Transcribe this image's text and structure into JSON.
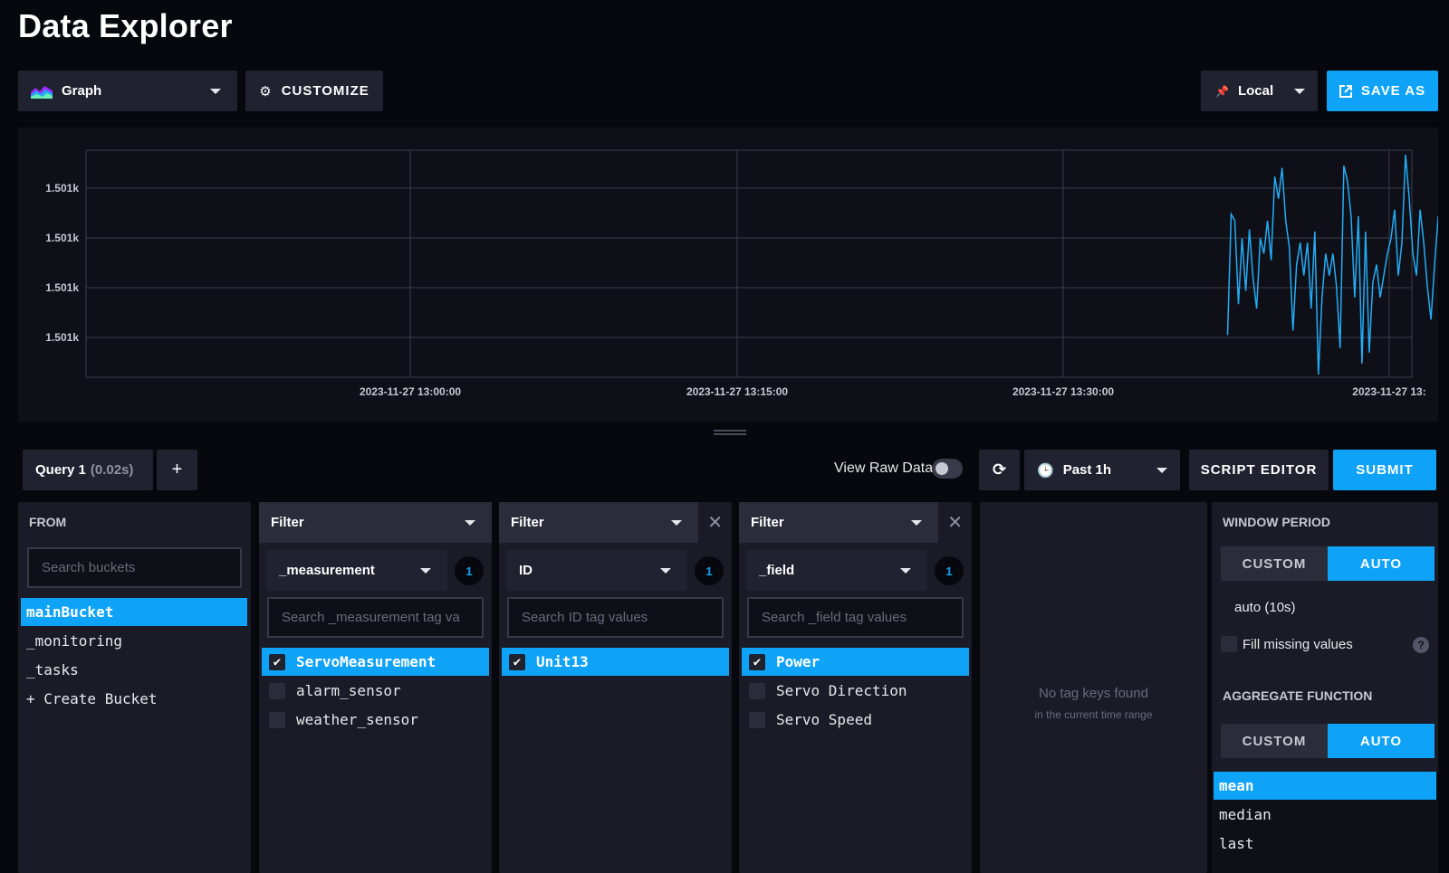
{
  "page": {
    "title": "Data Explorer"
  },
  "toolbar": {
    "graph_type": "Graph",
    "customize": "CUSTOMIZE",
    "timezone": "Local",
    "save_as": "SAVE AS"
  },
  "chart_data": {
    "type": "line",
    "title": "",
    "xlabel": "",
    "ylabel": "",
    "y_tick_labels": [
      "1.501k",
      "1.501k",
      "1.501k",
      "1.501k"
    ],
    "x_tick_labels": [
      "2023-11-27 13:00:00",
      "2023-11-27 13:15:00",
      "2023-11-27 13:30:00",
      "2023-11-27 13:"
    ],
    "grid": true,
    "series_color": "#22adf6",
    "series": [
      {
        "x": [
          "13:37:30",
          "13:37:40",
          "13:37:50",
          "13:38:00",
          "13:38:10",
          "13:38:20",
          "13:38:30",
          "13:38:40",
          "13:38:50",
          "13:39:00",
          "13:39:10",
          "13:39:20",
          "13:39:30",
          "13:39:40",
          "13:39:50",
          "13:40:00",
          "13:40:10",
          "13:40:20",
          "13:40:30",
          "13:40:40",
          "13:40:50",
          "13:41:00",
          "13:41:10",
          "13:41:20",
          "13:41:30",
          "13:41:40",
          "13:41:50",
          "13:42:00",
          "13:42:10",
          "13:42:20",
          "13:42:30",
          "13:42:40",
          "13:42:50",
          "13:43:00",
          "13:43:10",
          "13:43:20",
          "13:43:30",
          "13:43:40",
          "13:43:50",
          "13:44:00",
          "13:44:10",
          "13:44:20",
          "13:44:30",
          "13:44:40",
          "13:44:50",
          "13:45:00",
          "13:45:10",
          "13:45:20",
          "13:45:30",
          "13:45:40",
          "13:45:50",
          "13:46:00",
          "13:46:10",
          "13:46:20",
          "13:46:30",
          "13:46:40",
          "13:46:50",
          "13:47:00",
          "13:47:10",
          "13:47:20",
          "13:47:30"
        ],
        "values": [
          0.18,
          0.73,
          0.7,
          0.32,
          0.62,
          0.38,
          0.66,
          0.44,
          0.3,
          0.62,
          0.55,
          0.7,
          0.52,
          0.9,
          0.8,
          0.94,
          0.7,
          0.58,
          0.2,
          0.5,
          0.6,
          0.45,
          0.6,
          0.3,
          0.65,
          0.0,
          0.35,
          0.55,
          0.45,
          0.55,
          0.4,
          0.12,
          0.95,
          0.88,
          0.72,
          0.35,
          0.72,
          0.05,
          0.65,
          0.1,
          0.42,
          0.5,
          0.35,
          0.45,
          0.55,
          0.62,
          0.75,
          0.45,
          0.6,
          1.0,
          0.8,
          0.55,
          0.45,
          0.75,
          0.6,
          0.4,
          0.25,
          0.5,
          0.72,
          0.55,
          0.7
        ]
      }
    ]
  },
  "query": {
    "tab_label": "Query 1",
    "tab_timing": "(0.02s)",
    "add_label": "+",
    "view_raw": "View Raw Data",
    "time_range": "Past 1h",
    "script_editor": "SCRIPT EDITOR",
    "submit": "SUBMIT"
  },
  "from": {
    "title": "FROM",
    "search_placeholder": "Search buckets",
    "buckets": [
      "mainBucket",
      "_monitoring",
      "_tasks",
      "+ Create Bucket"
    ]
  },
  "filters": [
    {
      "label": "Filter",
      "key": "_measurement",
      "count": "1",
      "search_placeholder": "Search _measurement tag va",
      "items": [
        {
          "label": "ServoMeasurement",
          "checked": true
        },
        {
          "label": "alarm_sensor",
          "checked": false
        },
        {
          "label": "weather_sensor",
          "checked": false
        }
      ]
    },
    {
      "label": "Filter",
      "key": "ID",
      "count": "1",
      "search_placeholder": "Search ID tag values",
      "items": [
        {
          "label": "Unit13",
          "checked": true
        }
      ]
    },
    {
      "label": "Filter",
      "key": "_field",
      "count": "1",
      "search_placeholder": "Search _field tag values",
      "items": [
        {
          "label": "Power",
          "checked": true
        },
        {
          "label": "Servo Direction",
          "checked": false
        },
        {
          "label": "Servo Speed",
          "checked": false
        }
      ]
    }
  ],
  "empty": {
    "message": "No tag keys found",
    "sub": "in the current time range"
  },
  "window_period": {
    "title": "WINDOW PERIOD",
    "custom": "CUSTOM",
    "auto": "AUTO",
    "auto_value": "auto (10s)",
    "fill_missing": "Fill missing values",
    "help": "?"
  },
  "aggregate": {
    "title": "AGGREGATE FUNCTION",
    "custom": "CUSTOM",
    "auto": "AUTO",
    "functions": [
      "mean",
      "median",
      "last"
    ]
  },
  "icons": {
    "graph": "graph-type-icon",
    "gear": "gear-icon",
    "pin": "pin-icon",
    "external": "external-link-icon",
    "refresh": "refresh-icon",
    "clock": "clock-icon",
    "check": "checkmark-icon",
    "close": "close-icon"
  }
}
